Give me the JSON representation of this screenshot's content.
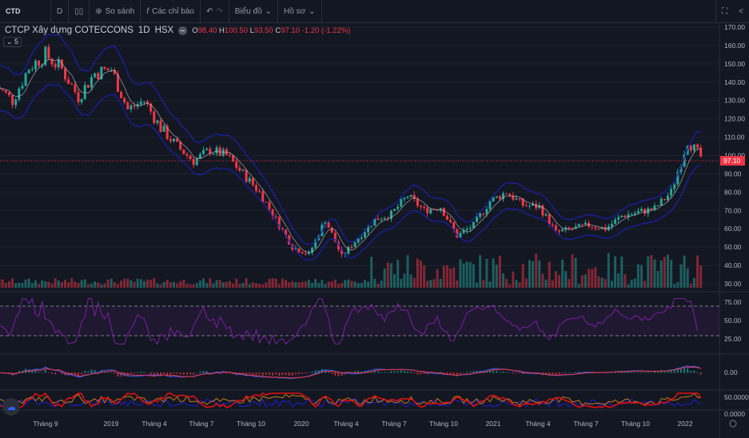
{
  "toolbar": {
    "symbol": "CTD",
    "interval": "D",
    "compare": "So sánh",
    "indicators": "Các chỉ báo",
    "chart": "Biểu đồ",
    "profile": "Hồ sơ"
  },
  "legend": {
    "name": "CTCP Xây dựng COTECCONS",
    "interval": "1D",
    "exchange": "HSX",
    "o_label": "O",
    "o": "98.40",
    "h_label": "H",
    "h": "100.50",
    "l_label": "L",
    "l": "93.50",
    "c_label": "C",
    "c": "97.10",
    "change": "-1.20 (-1.22%)",
    "collapse": "5"
  },
  "colors": {
    "up": "#26a69a",
    "down": "#f23645",
    "band": "#1a1fa8",
    "rsi": "#7b1fa2",
    "bg": "#131722"
  },
  "chart_data": {
    "type": "candlestick",
    "last_price": 97.1,
    "price_ticks": [
      "170.00",
      "160.00",
      "150.00",
      "140.00",
      "130.00",
      "120.00",
      "110.00",
      "100.00",
      "90.00",
      "80.00",
      "70.00",
      "60.00",
      "50.00",
      "40.00",
      "30.00"
    ],
    "ylim": [
      30,
      170
    ],
    "time_labels": [
      "Tháng 9",
      "2019",
      "Tháng 4",
      "Tháng 7",
      "Tháng 10",
      "2020",
      "Tháng 4",
      "Tháng 7",
      "Tháng 10",
      "2021",
      "Tháng 4",
      "Tháng 7",
      "Tháng 10",
      "2022"
    ],
    "monthly_close": [
      138,
      130,
      148,
      155,
      147,
      132,
      145,
      147,
      125,
      130,
      115,
      105,
      97,
      103,
      100,
      90,
      80,
      65,
      50,
      46,
      65,
      45,
      55,
      65,
      68,
      78,
      70,
      72,
      56,
      62,
      75,
      80,
      73,
      72,
      58,
      60,
      62,
      60,
      67,
      69,
      71,
      80,
      108,
      97
    ],
    "rsi_ticks": [
      "75.00",
      "50.00",
      "25.00"
    ],
    "macd_ticks": [
      "0.00"
    ],
    "adx_ticks": [
      "50.0000",
      "0.0000"
    ]
  }
}
